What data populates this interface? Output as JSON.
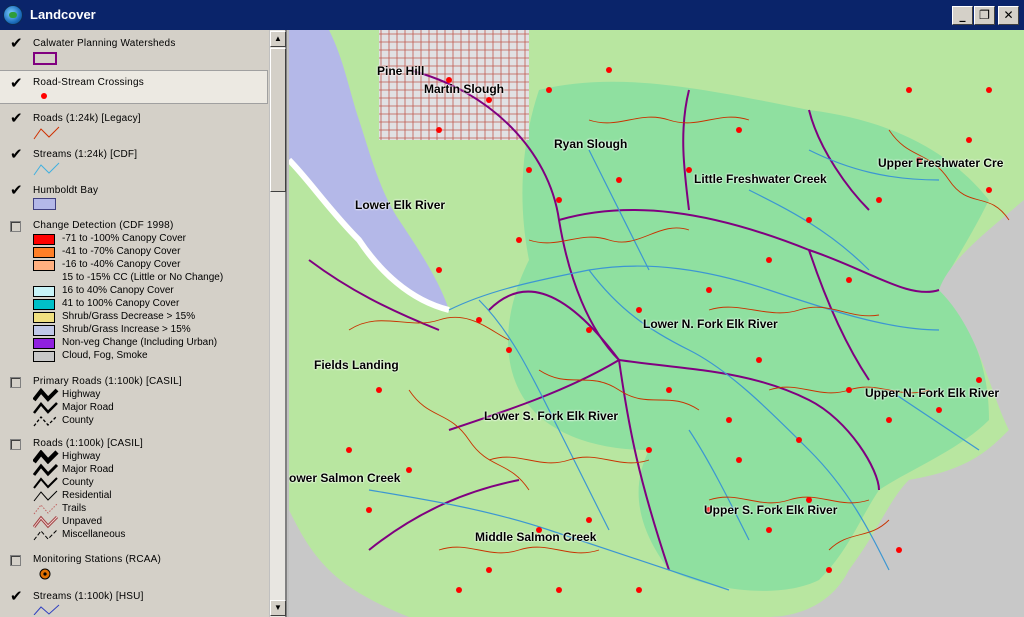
{
  "window": {
    "title": "Landcover"
  },
  "layers": [
    {
      "label": "Calwater Planning Watersheds",
      "checked": true
    },
    {
      "label": "Road-Stream Crossings",
      "checked": true
    },
    {
      "label": "Roads (1:24k) [Legacy]",
      "checked": true
    },
    {
      "label": "Streams (1:24k) [CDF]",
      "checked": true
    },
    {
      "label": "Humboldt Bay",
      "checked": true
    },
    {
      "label": "Change Detection (CDF 1998)",
      "checked": false,
      "items": [
        {
          "label": "-71 to -100% Canopy Cover",
          "color": "#ff0000"
        },
        {
          "label": "-41 to -70% Canopy Cover",
          "color": "#ff7f27"
        },
        {
          "label": "-16 to -40% Canopy Cover",
          "color": "#ffb080"
        },
        {
          "label": "15 to -15% CC (Little or No Change)",
          "color": ""
        },
        {
          "label": "16 to 40% Canopy Cover",
          "color": "#c8f4f8"
        },
        {
          "label": "41 to 100% Canopy Cover",
          "color": "#00c0c8"
        },
        {
          "label": "Shrub/Grass Decrease > 15%",
          "color": "#f0e080"
        },
        {
          "label": "Shrub/Grass Increase > 15%",
          "color": "#c0c8e8"
        },
        {
          "label": "Non-veg Change (Including Urban)",
          "color": "#9020e0"
        },
        {
          "label": "Cloud, Fog, Smoke",
          "color": "#c8c8c8"
        }
      ]
    },
    {
      "label": "Primary Roads (1:100k) [CASIL]",
      "checked": false,
      "items": [
        "Highway",
        "Major Road",
        "County"
      ]
    },
    {
      "label": "Roads (1:100k) [CASIL]",
      "checked": false,
      "items": [
        "Highway",
        "Major Road",
        "County",
        "Residential",
        "Trails",
        "Unpaved",
        "Miscellaneous"
      ]
    },
    {
      "label": "Monitoring Stations (RCAA)",
      "checked": false
    },
    {
      "label": "Streams (1:100k) [HSU]",
      "checked": true
    }
  ],
  "map": {
    "places": [
      "Pine Hill",
      "Martin Slough",
      "Ryan Slough",
      "Upper Freshwater Cre",
      "Little Freshwater Creek",
      "Lower Elk River",
      "Lower N. Fork Elk River",
      "Fields Landing",
      "Upper N. Fork Elk River",
      "Lower S. Fork Elk River",
      "ower Salmon Creek",
      "Upper S. Fork Elk River",
      "Middle Salmon Creek"
    ]
  },
  "colors": {
    "titlebar": "#0a246a",
    "bay": "#b4b8e8",
    "land_green": "#b8e6a0",
    "forest": "#8fe0a0",
    "roads": "#c83200",
    "streams": "#3c96d2",
    "watersheds": "#800080",
    "crossings": "#ff0000"
  }
}
